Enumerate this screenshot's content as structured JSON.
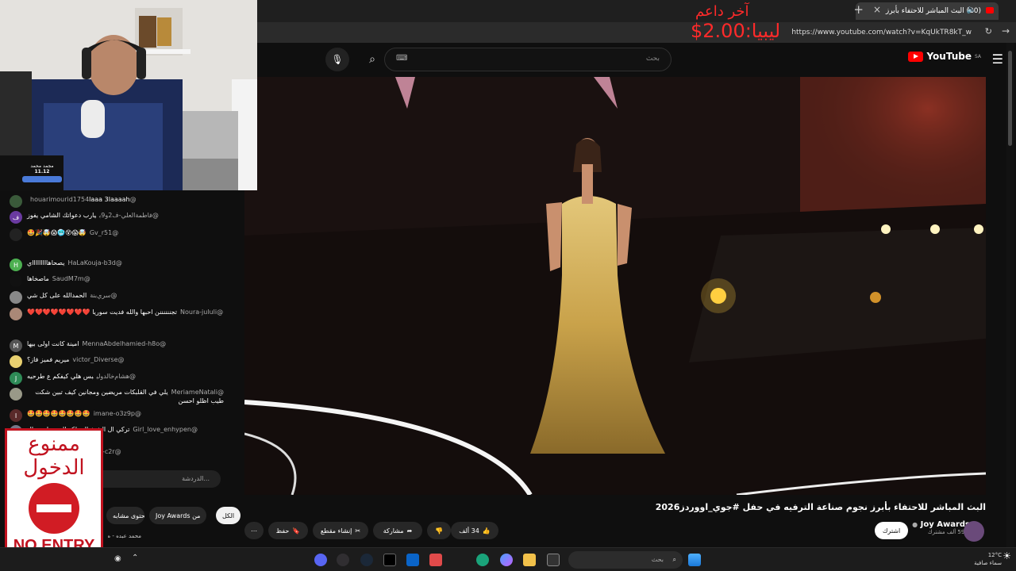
{
  "browser": {
    "tab_title": "(20) البث المباشر للاحتفاء بأبرز",
    "new_tab": "+",
    "url": "https://www.youtube.com/watch?v=KqUkTR8kT_w",
    "close_tab": "×"
  },
  "overlay": {
    "line1": "آخر داعم",
    "line2": "ليبيا:2.00$"
  },
  "youtube": {
    "logo_text": "YouTube",
    "region": "SA",
    "search_placeholder": "بحث"
  },
  "video": {
    "title": "البث المباشر للاحتفاء بأبرز نجوم صناعة الترفيه في حفل #جوي_اووردز2026",
    "hashtag": "#جوي_اووردز2026"
  },
  "channel": {
    "name": "Joy Awards",
    "subscribers": "59.7 ألف مشترك",
    "subscribe_label": "اشترك"
  },
  "actions": {
    "likes": "34 ألف",
    "share": "مشاركة",
    "clip": "إنشاء مقطع",
    "save": "حفظ",
    "more": "⋯"
  },
  "chips": [
    "الكل",
    "من Joy Awards",
    "محتوى مشابه"
  ],
  "webcam_overlay": {
    "name": "مجمد محمد",
    "value": "11.12"
  },
  "chat": {
    "input_placeholder": "الدردشة...",
    "messages": [
      {
        "user": "@houarimourid1754",
        "text": "laaa 3laaaah",
        "avatar": "",
        "color": "#3a5a3a"
      },
      {
        "user": "@فاطمة‌العلي‌-ف2و9ب",
        "text": "يارب دعواتك الشامي يفوز",
        "avatar": "ف",
        "color": "#6a3aa0"
      },
      {
        "user": "@Gv_r51",
        "text": "🤯😱😵🥶😱🤯🎉🤩",
        "avatar": "",
        "color": "#222"
      },
      {
        "user": "@HaLaKouja-b3d",
        "text": "يصحاهاااااااااي",
        "avatar": "H",
        "color": "#4caf50"
      },
      {
        "user": "@SaudM7m",
        "text": "ماصخاها",
        "avatar": "",
        "color": "#111"
      },
      {
        "user": "@سري‌بنة",
        "text": "الحمدالله على كل شي",
        "avatar": "",
        "color": "#888"
      },
      {
        "user": "@Noura-jululi",
        "text": "تجننننننن احبها والله فديت سوريا ❤️❤️❤️❤️❤️❤️❤️❤️",
        "avatar": "",
        "color": "#a87"
      },
      {
        "user": "@MennaAbdelhamied-h8o",
        "text": "امينة كانت اولى بيها",
        "avatar": "M",
        "color": "#555"
      },
      {
        "user": "@victor_Diverse",
        "text": "ميريم فميز فاز؟",
        "avatar": "",
        "color": "#e8d070"
      },
      {
        "user": "@هشام‌خالد‌ولي",
        "text": "بس هلي كيفكم ع طرحيه",
        "avatar": "J",
        "color": "#2e8b57"
      },
      {
        "user": "@MeriameNatali",
        "text": "يلي في القلبكات مريضين ومجانين كيف تبين شكت طيب اظلو احسن",
        "avatar": "",
        "color": "#998"
      },
      {
        "user": "@imane-o3z9p",
        "text": "🤩🤩🤩🤩🤩🤩🤩🤩",
        "avatar": "I",
        "color": "#5a2a2a"
      },
      {
        "user": "@Girl_love_enhypen",
        "text": "تركي ال الشيخ المملكه البنت يلي عبال",
        "avatar": "",
        "color": "#778"
      },
      {
        "user": "@FatimaazzahraFatima-c2r",
        "text": "ل",
        "avatar": "F",
        "color": "#e64a19"
      }
    ]
  },
  "noentry": {
    "ar_line1": "ممنوع",
    "ar_line2": "الدخول",
    "en": "NO ENTRY"
  },
  "below_chat": {
    "preview_text": "محمد عبده - ه"
  },
  "taskbar": {
    "search_placeholder": "بحث",
    "temp": "12°C",
    "weather": "سماء صافية"
  }
}
